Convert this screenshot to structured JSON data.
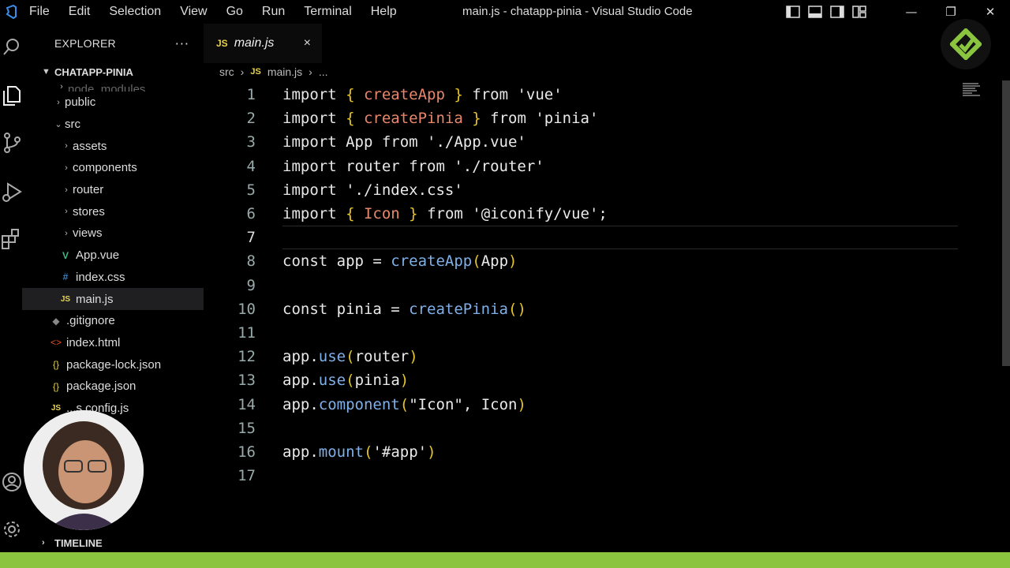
{
  "window": {
    "title": "main.js - chatapp-pinia - Visual Studio Code"
  },
  "menu": [
    "File",
    "Edit",
    "Selection",
    "View",
    "Go",
    "Run",
    "Terminal",
    "Help"
  ],
  "sidebar": {
    "title": "EXPLORER",
    "more": "···",
    "project": "CHATAPP-PINIA",
    "items": [
      {
        "label": "node_modules",
        "type": "folder",
        "depth": 1,
        "expanded": false
      },
      {
        "label": "public",
        "type": "folder",
        "depth": 1,
        "expanded": false
      },
      {
        "label": "src",
        "type": "folder",
        "depth": 1,
        "expanded": true
      },
      {
        "label": "assets",
        "type": "folder",
        "depth": 2,
        "expanded": false
      },
      {
        "label": "components",
        "type": "folder",
        "depth": 2,
        "expanded": false
      },
      {
        "label": "router",
        "type": "folder",
        "depth": 2,
        "expanded": false
      },
      {
        "label": "stores",
        "type": "folder",
        "depth": 2,
        "expanded": false
      },
      {
        "label": "views",
        "type": "folder",
        "depth": 2,
        "expanded": false
      },
      {
        "label": "App.vue",
        "type": "vue",
        "depth": 2
      },
      {
        "label": "index.css",
        "type": "css",
        "depth": 2
      },
      {
        "label": "main.js",
        "type": "js",
        "depth": 2,
        "selected": true
      },
      {
        "label": ".gitignore",
        "type": "git",
        "depth": 1
      },
      {
        "label": "index.html",
        "type": "html",
        "depth": 1
      },
      {
        "label": "package-lock.json",
        "type": "json",
        "depth": 1
      },
      {
        "label": "package.json",
        "type": "json",
        "depth": 1
      },
      {
        "label": "...s.config.js",
        "type": "js",
        "depth": 1
      }
    ],
    "timeline": "TIMELINE"
  },
  "editor": {
    "tab": {
      "label": "main.js",
      "badge": "JS",
      "close": "×"
    },
    "breadcrumb": {
      "folder": "src",
      "badge": "JS",
      "file": "main.js",
      "more": "..."
    },
    "current_line": 7
  },
  "colors": {
    "status_bar": "#8bc53f",
    "accent": "#8bc53f"
  },
  "icons": {
    "activity": [
      "search-icon",
      "explorer-icon",
      "source-control-icon",
      "run-debug-icon",
      "extensions-icon",
      "account-icon",
      "settings-icon"
    ]
  }
}
